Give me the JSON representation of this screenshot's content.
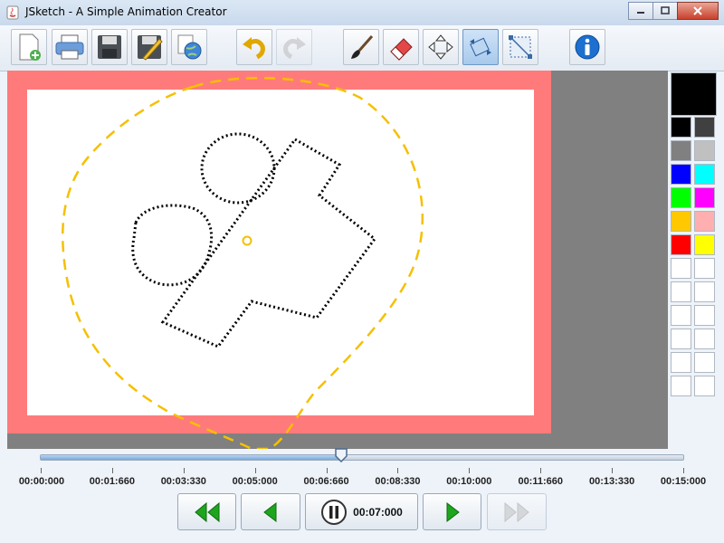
{
  "window": {
    "title": "JSketch - A Simple Animation Creator"
  },
  "toolbar": {
    "buttons": [
      {
        "name": "new-file-button",
        "icon": "new-file-icon"
      },
      {
        "name": "print-button",
        "icon": "printer-icon"
      },
      {
        "name": "save-button",
        "icon": "floppy-disk-icon"
      },
      {
        "name": "save-as-button",
        "icon": "floppy-pencil-icon"
      },
      {
        "name": "export-web-button",
        "icon": "globe-icon"
      },
      {
        "name": "undo-button",
        "icon": "undo-icon"
      },
      {
        "name": "redo-button",
        "icon": "redo-icon",
        "disabled": true
      },
      {
        "name": "brush-tool-button",
        "icon": "paintbrush-icon"
      },
      {
        "name": "eraser-tool-button",
        "icon": "eraser-icon"
      },
      {
        "name": "move-tool-button",
        "icon": "move-arrows-icon"
      },
      {
        "name": "rotate-tool-button",
        "icon": "rotate-icon",
        "active": true
      },
      {
        "name": "scale-tool-button",
        "icon": "scale-icon"
      },
      {
        "name": "info-button",
        "icon": "info-icon"
      }
    ]
  },
  "palette": {
    "current": "#000000",
    "swatches": [
      "#000000",
      "#404040",
      "#808080",
      "#c0c0c0",
      "#0000ff",
      "#00ffff",
      "#00ff00",
      "#ff00ff",
      "#ffc800",
      "#ffafaf",
      "#ff0000",
      "#ffff00",
      "#ffffff",
      "#ffffff",
      "#ffffff",
      "#ffffff",
      "#ffffff",
      "#ffffff",
      "#ffffff",
      "#ffffff",
      "#ffffff",
      "#ffffff",
      "#ffffff",
      "#ffffff"
    ]
  },
  "colors": {
    "frame": "#ff7b7b",
    "selection": "#f5c000",
    "workspace": "#808080"
  },
  "timeline": {
    "labels": [
      "00:00:000",
      "00:01:660",
      "00:03:330",
      "00:05:000",
      "00:06:660",
      "00:08:330",
      "00:10:000",
      "00:11:660",
      "00:13:330",
      "00:15:000"
    ],
    "position_fraction": 0.467
  },
  "playback": {
    "rewind_icon": "rewind-icon",
    "prev_icon": "previous-frame-icon",
    "pause_icon": "pause-icon",
    "current_time": "00:07:000",
    "next_icon": "next-frame-icon",
    "ff_icon": "fast-forward-icon"
  }
}
